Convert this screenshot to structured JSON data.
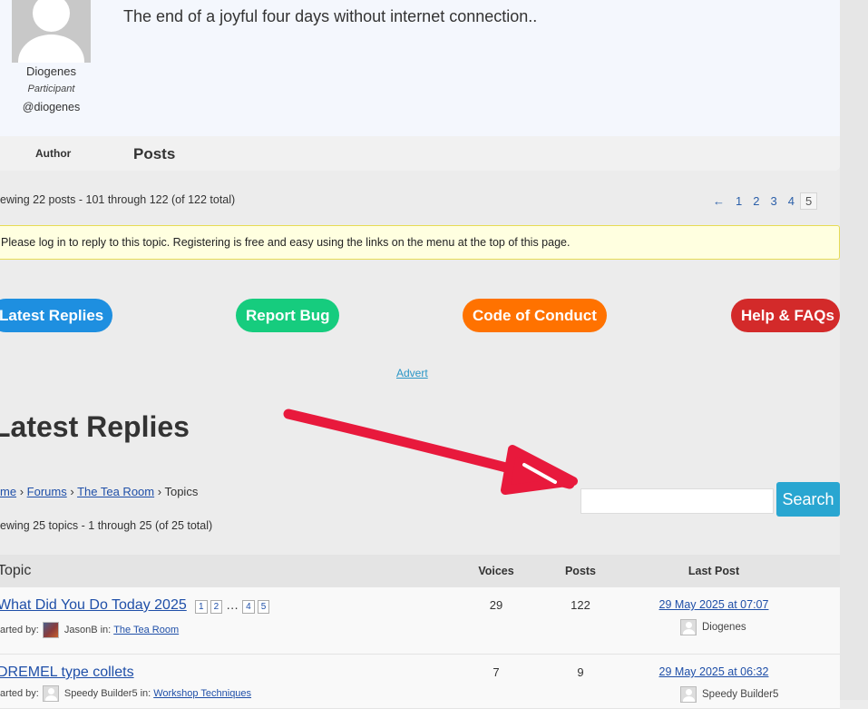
{
  "post": {
    "author_name": "Diogenes",
    "author_role": "Participant",
    "author_handle": "@diogenes",
    "text": "The end of a joyful four days without internet connection..",
    "col_author": "Author",
    "col_posts": "Posts"
  },
  "viewing_posts": "ewing 22 posts - 101 through 122 (of 122 total)",
  "pagination": {
    "prev": "←",
    "pages": [
      "1",
      "2",
      "3",
      "4"
    ],
    "current": "5"
  },
  "notice": "Please log in to reply to this topic. Registering is free and easy using the links on the menu at the top of this page.",
  "buttons": {
    "latest_replies": "Latest Replies",
    "report_bug": "Report Bug",
    "code_of_conduct": "Code of Conduct",
    "help_faqs": "Help & FAQs"
  },
  "advert": "Advert",
  "section_title": "Latest Replies",
  "breadcrumb": {
    "home": "me",
    "sep": "›",
    "forums": "Forums",
    "tea_room": "The Tea Room",
    "current": "Topics"
  },
  "search": {
    "placeholder": "",
    "button": "Search"
  },
  "viewing_topics": "ewing 25 topics - 1 through 25 (of 25 total)",
  "table": {
    "headers": {
      "topic": "Topic",
      "voices": "Voices",
      "posts": "Posts",
      "last_post": "Last Post"
    },
    "rows": [
      {
        "title": "What Did You Do Today 2025",
        "mini_pages": [
          "1",
          "2",
          "…",
          "4",
          "5"
        ],
        "started_by_label": "tarted by:",
        "starter": "JasonB",
        "in_label": "in:",
        "forum": "The Tea Room",
        "voices": "29",
        "posts": "122",
        "last_date": "29 May 2025 at 07:07",
        "last_user": "Diogenes"
      },
      {
        "title": "DREMEL type collets",
        "started_by_label": "tarted by:",
        "starter": "Speedy Builder5",
        "in_label": "in:",
        "forum": "Workshop Techniques",
        "voices": "7",
        "posts": "9",
        "last_date": "29 May 2025 at 06:32",
        "last_user": "Speedy Builder5"
      }
    ]
  },
  "colors": {
    "blue": "#1e8fe0",
    "green": "#16cc7e",
    "orange": "#ff7200",
    "red": "#d32a2a",
    "arrow": "#e8193c",
    "search_button": "#29a6d1",
    "link": "#1f4fa8"
  }
}
